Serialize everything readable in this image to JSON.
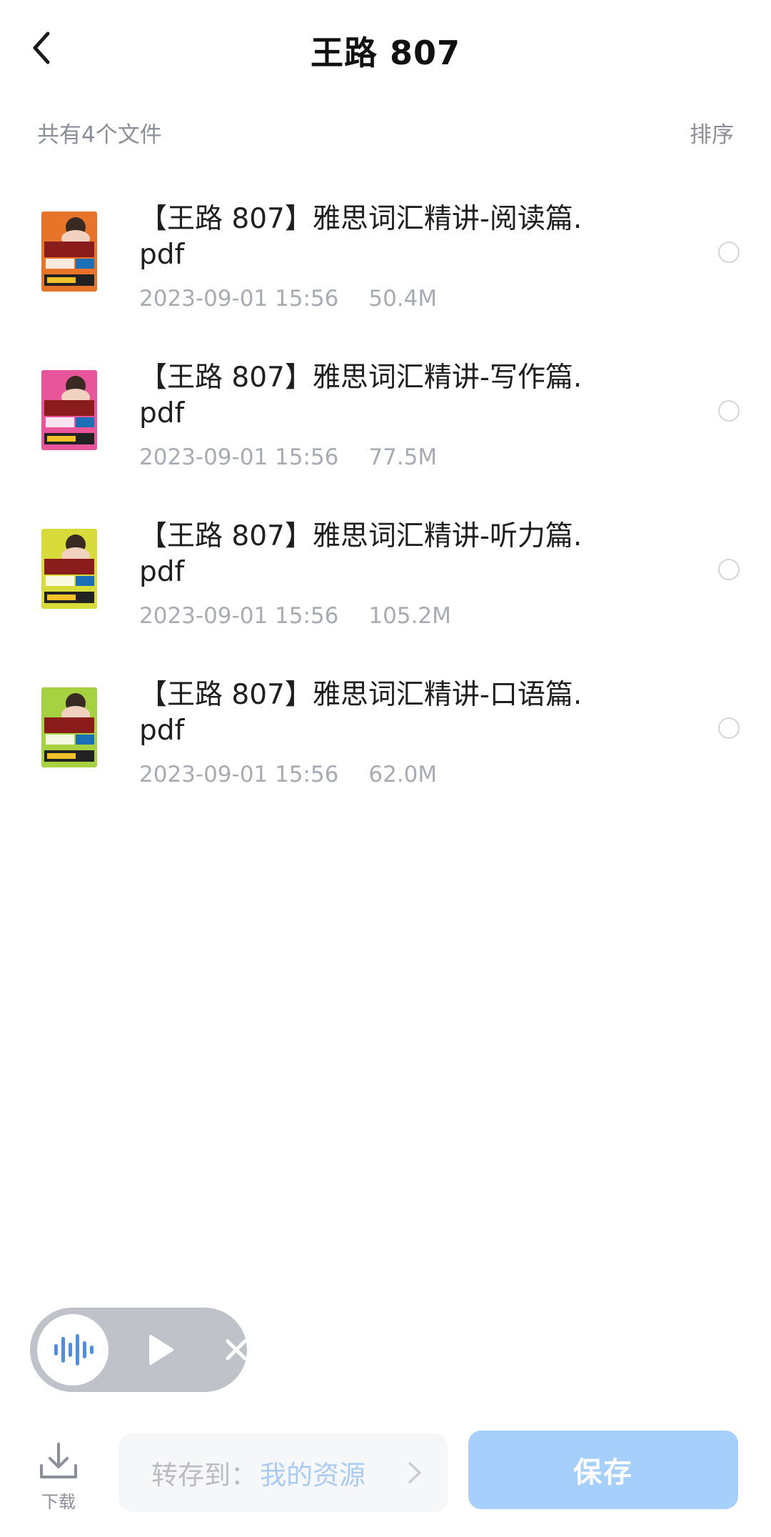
{
  "header": {
    "title": "王路 807"
  },
  "summary": {
    "file_count": "共有4个文件",
    "sort_label": "排序"
  },
  "files": [
    {
      "name": "【王路 807】雅思词汇精讲-阅读篇.pdf",
      "date": "2023-09-01 15:56",
      "size": "50.4M",
      "cover_color": "#e8742a",
      "cover_tag": "阅读篇"
    },
    {
      "name": "【王路 807】雅思词汇精讲-写作篇.pdf",
      "date": "2023-09-01 15:56",
      "size": "77.5M",
      "cover_color": "#e8559a",
      "cover_tag": "写作篇"
    },
    {
      "name": "【王路 807】雅思词汇精讲-听力篇.pdf",
      "date": "2023-09-01 15:56",
      "size": "105.2M",
      "cover_color": "#d8dc3a",
      "cover_tag": "听力篇"
    },
    {
      "name": "【王路 807】雅思词汇精讲-口语篇.pdf",
      "date": "2023-09-01 15:56",
      "size": "62.0M",
      "cover_color": "#a6d140",
      "cover_tag": "口语篇"
    }
  ],
  "bottom_bar": {
    "download_label": "下载",
    "save_to_label": "转存到：",
    "save_to_target": "我的资源",
    "save_button": "保存"
  },
  "colors": {
    "accent": "#a6d0fb",
    "secondary_text": "#8b8f99",
    "meta_text": "#a7abb3"
  },
  "icons": {
    "back": "chevron-left-icon",
    "radio": "radio-unchecked-icon",
    "audio_wave": "audio-wave-icon",
    "play": "play-icon",
    "close": "close-icon",
    "download": "download-icon",
    "chevron": "chevron-right-icon"
  }
}
